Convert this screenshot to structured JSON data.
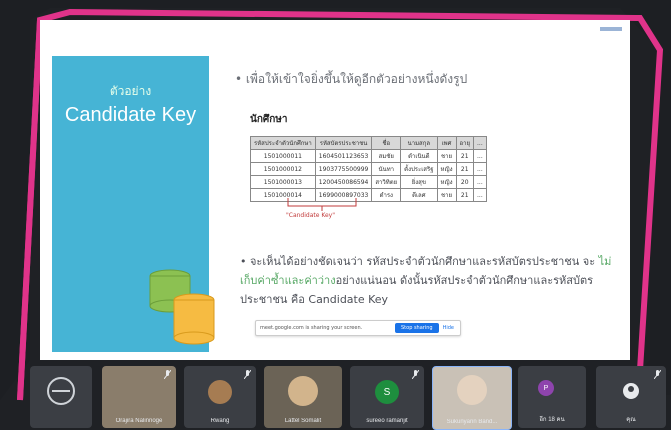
{
  "slide": {
    "teal_heading_small": "ตัวอย่าง",
    "teal_heading_large": "Candidate Key",
    "bullet1": "• เพื่อให้เข้าใจยิ่งขึ้นให้ดูอีกตัวอย่างหนึ่งดังรูป",
    "table_title": "นักศึกษา",
    "table": {
      "headers": [
        "รหัสประจำตัวนักศึกษา",
        "รหัสบัตรประชาชน",
        "ชื่อ",
        "นามสกุล",
        "เพศ",
        "อายุ",
        "..."
      ],
      "rows": [
        [
          "1501000011",
          "1604501123653",
          "สมชัย",
          "ดำเนินดี",
          "ชาย",
          "21",
          "..."
        ],
        [
          "1501000012",
          "1903775500999",
          "นันทา",
          "ตั้งประเสริฐ",
          "หญิง",
          "21",
          "..."
        ],
        [
          "1501000013",
          "1200450086594",
          "สาวิทิตย",
          "ยิ่งสุข",
          "หญิง",
          "20",
          "..."
        ],
        [
          "1501000014",
          "1699000897033",
          "ดำรง",
          "ดีเลศ",
          "ชาย",
          "21",
          "..."
        ]
      ]
    },
    "candidate_key_label": "\"Candidate Key\"",
    "bullet2_part1": "• จะเห็นได้อย่างชัดเจนว่า รหัสประจำตัวนักศึกษาและรหัสบัตรประชาชน จะ",
    "bullet2_highlight": "ไม่เก็บค่าซ้ำและค่าว่าง",
    "bullet2_part2": "อย่างแน่นอน ดังนั้นรหัสประจำตัวนักศึกษาและรหัสบัตรประชาชน คือ Candidate Key",
    "share_bar": {
      "text": "meet.google.com is sharing your screen.",
      "stop_label": "Stop sharing",
      "hide_label": "Hide"
    }
  },
  "participants": [
    {
      "name": "",
      "initial": "",
      "color": "#2d2f34"
    },
    {
      "name": "Orajira Nalinnoge",
      "initial": "",
      "color": "#8a7d6b"
    },
    {
      "name": "Rwang",
      "initial": "",
      "color": "#4a4d55"
    },
    {
      "name": "Lattel Somalit",
      "initial": "",
      "color": "#6b6356"
    },
    {
      "name": "sureeo ramanjit",
      "initial": "S",
      "color": "#1e8e3e"
    },
    {
      "name": "Sukunyarin Band...",
      "initial": "",
      "color": "#c9c1b6"
    },
    {
      "name": "อีก 18 คน",
      "initial": "P",
      "color": "#8e44ad"
    },
    {
      "name": "คุณ",
      "initial": "",
      "color": "#2b2d31"
    }
  ]
}
